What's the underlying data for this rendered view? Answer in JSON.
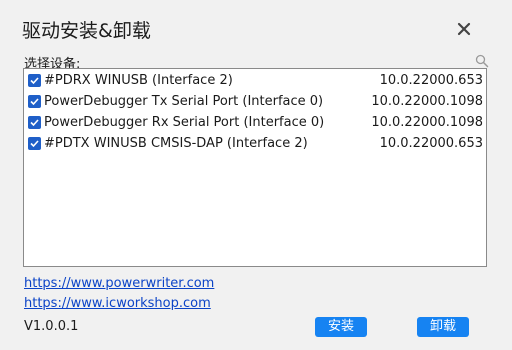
{
  "window": {
    "title": "驱动安装&卸载",
    "close_icon": "close-icon"
  },
  "device_list": {
    "label": "选择设备:",
    "search_icon": "search-icon",
    "items": [
      {
        "checked": true,
        "name": "#PDRX  WINUSB (Interface 2)",
        "version": "10.0.22000.653"
      },
      {
        "checked": true,
        "name": "PowerDebugger Tx Serial Port (Interface 0)",
        "version": "10.0.22000.1098"
      },
      {
        "checked": true,
        "name": "PowerDebugger Rx Serial Port (Interface 0)",
        "version": "10.0.22000.1098"
      },
      {
        "checked": true,
        "name": "#PDTX  WINUSB  CMSIS-DAP (Interface 2)",
        "version": "10.0.22000.653"
      }
    ]
  },
  "links": {
    "powerwriter": "https://www.powerwriter.com",
    "icworkshop": "https://www.icworkshop.com"
  },
  "footer": {
    "version": "V1.0.0.1",
    "install_label": "安装",
    "uninstall_label": "卸载"
  },
  "colors": {
    "accent": "#1683f2",
    "checkbox": "#1f5fc8",
    "link": "#0b43c7",
    "background": "#f1f1f1"
  }
}
